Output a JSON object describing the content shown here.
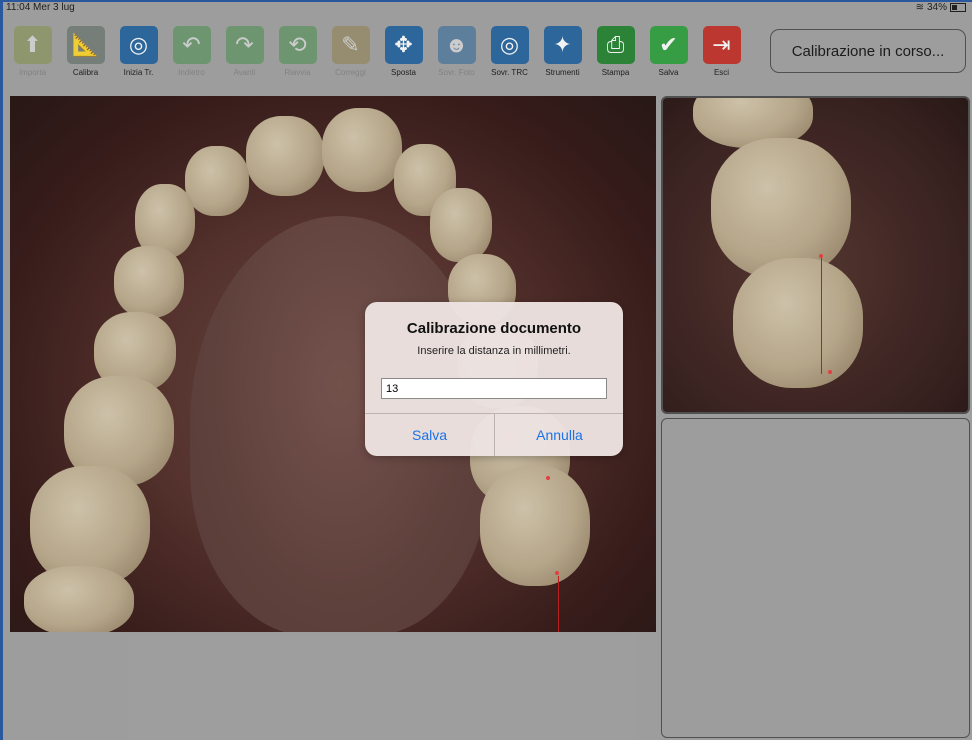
{
  "status_bar": {
    "time_date": "11:04  Mer 3 lug",
    "battery": "34%"
  },
  "toolbar": {
    "items": [
      {
        "label": "Importa",
        "icon": "folder-import-icon",
        "glyph": "⬆",
        "disabled": true
      },
      {
        "label": "Calibra",
        "icon": "ruler-calibrate-icon",
        "glyph": "📏",
        "disabled": false
      },
      {
        "label": "Inizia Tr.",
        "icon": "start-trace-icon",
        "glyph": "◎",
        "disabled": false
      },
      {
        "label": "Indietro",
        "icon": "undo-icon",
        "glyph": "↶",
        "disabled": true
      },
      {
        "label": "Avanti",
        "icon": "redo-icon",
        "glyph": "↷",
        "disabled": true
      },
      {
        "label": "Riavvia",
        "icon": "restart-icon",
        "glyph": "⟲",
        "disabled": true
      },
      {
        "label": "Correggi",
        "icon": "correct-icon",
        "glyph": "✎",
        "disabled": true
      },
      {
        "label": "Sposta",
        "icon": "move-icon",
        "glyph": "✥",
        "disabled": false
      },
      {
        "label": "Sovr. Foto",
        "icon": "overlay-photo-icon",
        "glyph": "👤",
        "disabled": true
      },
      {
        "label": "Sovr. TRC",
        "icon": "overlay-trc-icon",
        "glyph": "◎",
        "disabled": false
      },
      {
        "label": "Strumenti",
        "icon": "tools-wand-icon",
        "glyph": "✦",
        "disabled": false
      },
      {
        "label": "Stampa",
        "icon": "print-icon",
        "glyph": "⎙",
        "disabled": false
      },
      {
        "label": "Salva",
        "icon": "save-check-icon",
        "glyph": "✔",
        "disabled": false
      },
      {
        "label": "Esci",
        "icon": "exit-icon",
        "glyph": "⇥",
        "disabled": false
      }
    ]
  },
  "calibration_status": "Calibrazione in corso...",
  "dialog": {
    "title": "Calibrazione documento",
    "message": "Inserire la distanza in millimetri.",
    "input_value": "13",
    "save_label": "Salva",
    "cancel_label": "Annulla"
  },
  "colors": {
    "link_blue": "#1a73e8",
    "frame_blue": "#2d5da8",
    "measure_red": "#c62222"
  }
}
